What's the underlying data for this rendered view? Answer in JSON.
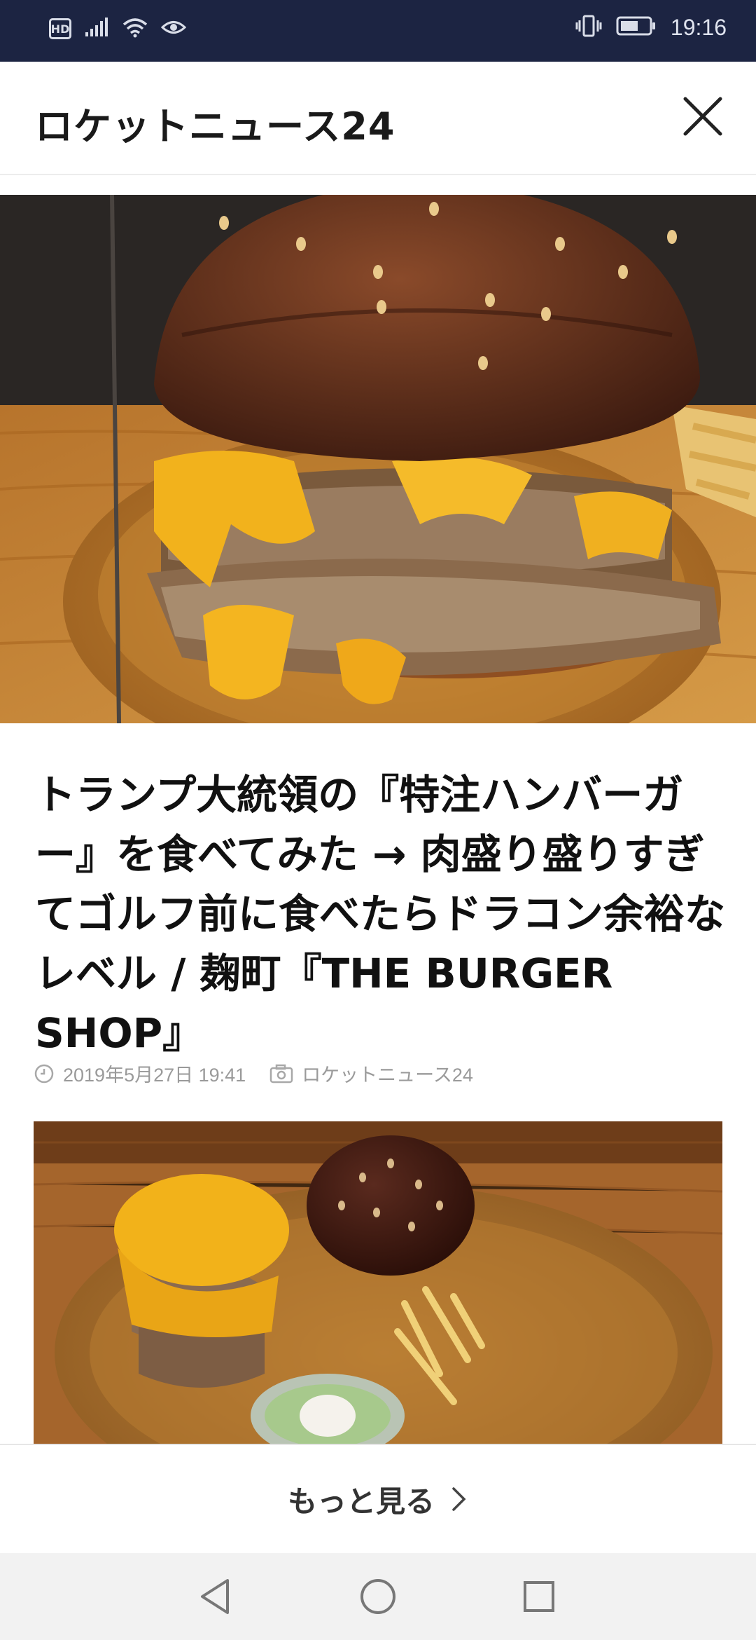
{
  "status_bar": {
    "time": "19:16",
    "network_badge": "HD",
    "icons": [
      "signal-icon",
      "wifi-icon",
      "eye-icon",
      "vibrate-icon",
      "battery-icon"
    ]
  },
  "header": {
    "title": "ロケットニュース24",
    "close_icon": "close-icon"
  },
  "article": {
    "headline": "トランプ大統領の『特注ハンバーガー』を食べてみた → 肉盛り盛りすぎてゴルフ前に食べたらドラコン余裕なレベル / 麹町『THE BURGER SHOP』",
    "date": "2019年5月27日 19:41",
    "source": "ロケットニュース24"
  },
  "footer": {
    "more_label": "もっと見る"
  },
  "nav": {
    "icons": [
      "back-icon",
      "home-icon",
      "recents-icon"
    ]
  },
  "colors": {
    "status_bar": "#1c2442",
    "meta_text": "#9a9a9a",
    "nav_bar": "#f2f2f2"
  }
}
